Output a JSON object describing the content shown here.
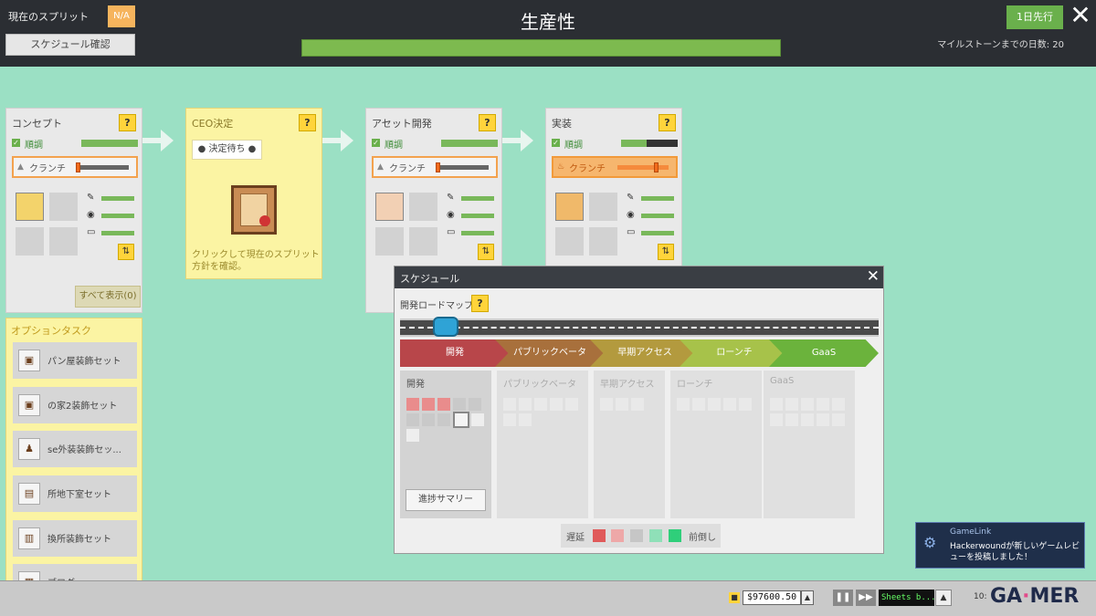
{
  "topbar": {
    "current_split_label": "現在のスプリット",
    "current_split_value": "N/A",
    "schedule_button": "スケジュール確認",
    "title": "生産性",
    "next_day_button": "1日先行",
    "milestone_text": "マイルストーンまでの日数: 20",
    "productivity_fraction": 1.0
  },
  "stages": [
    {
      "title": "コンセプト",
      "help": "?",
      "status": "順調",
      "status_progress": 1.0,
      "crunch": "クランチ",
      "crunch_level": 0.0,
      "swap": "⇅",
      "show_all": "すべて表示(0)"
    },
    {
      "title": "CEO決定",
      "help": "?",
      "pending": "決定待ち",
      "hint": "クリックして現在のスプリット方針を確認。"
    },
    {
      "title": "アセット開発",
      "help": "?",
      "status": "順調",
      "status_progress": 1.0,
      "crunch": "クランチ",
      "crunch_level": 0.0,
      "swap": "⇅"
    },
    {
      "title": "実装",
      "help": "?",
      "status": "順調",
      "status_progress": 0.45,
      "crunch": "クランチ",
      "crunch_level": 0.75,
      "swap": "⇅"
    }
  ],
  "optional_tasks": {
    "title": "オプションタスク",
    "items": [
      {
        "label": "パン屋装飾セット"
      },
      {
        "label": "の家2装飾セット"
      },
      {
        "label": "se外装装飾セッ..."
      },
      {
        "label": "所地下室セット"
      },
      {
        "label": "換所装飾セット"
      },
      {
        "label": "ブログ..."
      }
    ]
  },
  "schedule": {
    "title": "スケジュール",
    "roadmap_label": "開発ロードマップ",
    "help": "?",
    "phases": [
      {
        "label": "開発",
        "color": "#b8464a"
      },
      {
        "label": "パブリックベータ",
        "color": "#a8703c"
      },
      {
        "label": "早期アクセス",
        "color": "#b39a3e"
      },
      {
        "label": "ローンチ",
        "color": "#a7c24a"
      },
      {
        "label": "GaaS",
        "color": "#6bb33c"
      }
    ],
    "columns": [
      {
        "label": "開発"
      },
      {
        "label": "パブリックベータ"
      },
      {
        "label": "早期アクセス"
      },
      {
        "label": "ローンチ"
      },
      {
        "label": "GaaS"
      }
    ],
    "progress_summary_button": "進捗サマリー",
    "legend": {
      "left": "遅延",
      "right": "前倒し",
      "colors": [
        "#e05a5a",
        "#eea8a8",
        "#c6c6c6",
        "#8fe0b8",
        "#2fcf7a"
      ]
    }
  },
  "notification": {
    "title": "GameLink",
    "body": "Hackerwoundが新しいゲームレビューを投稿しました！"
  },
  "bottombar": {
    "money": "$97600.50",
    "ticker": "Sheets b...",
    "clock": "10:",
    "brand_prefix": "GA",
    "brand_suffix": "MER"
  }
}
